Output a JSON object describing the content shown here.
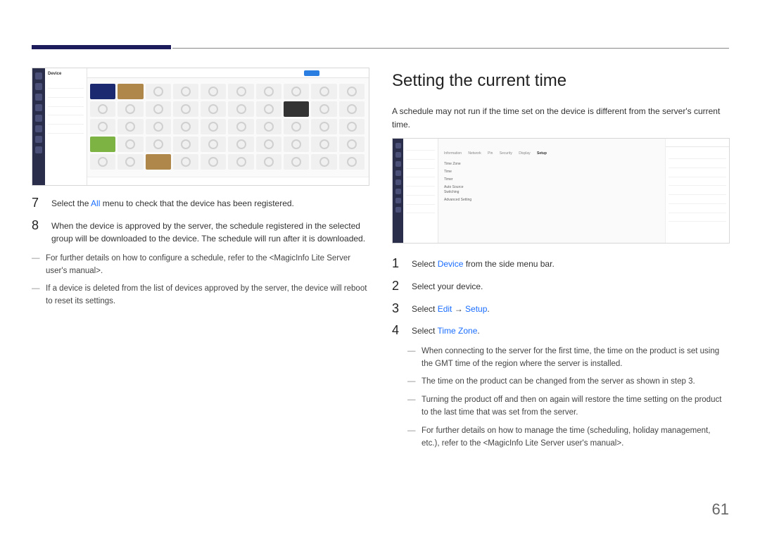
{
  "page_number": "61",
  "left": {
    "screenshot": {
      "sidepanel_title": "Device",
      "topbar_label": "All"
    },
    "steps": [
      {
        "num": "7",
        "pre": "Select the ",
        "link": "All",
        "post": " menu to check that the device has been registered."
      },
      {
        "num": "8",
        "text": "When the device is approved by the server, the schedule registered in the selected group will be downloaded to the device. The schedule will run after it is downloaded."
      }
    ],
    "notes": [
      "For further details on how to configure a schedule, refer to the <MagicInfo Lite Server user's manual>.",
      "If a device is deleted from the list of devices approved by the server, the device will reboot to reset its settings."
    ]
  },
  "right": {
    "title": "Setting the current time",
    "intro": "A schedule may not run if the time set on the device is different from the server's current time.",
    "screenshot": {
      "tabs": [
        "Information",
        "Network",
        "Pin",
        "Security",
        "Display",
        "Setup"
      ],
      "active_tab": "Setup",
      "fields": [
        "Time Zone",
        "Time",
        "Timer",
        "Auto Source Switching",
        "Advanced Setting"
      ]
    },
    "steps": [
      {
        "num": "1",
        "parts": [
          "Select ",
          {
            "link": "Device"
          },
          " from the side menu bar."
        ]
      },
      {
        "num": "2",
        "parts": [
          "Select your device."
        ]
      },
      {
        "num": "3",
        "parts": [
          "Select ",
          {
            "link": "Edit"
          },
          " → ",
          {
            "link": "Setup"
          },
          "."
        ]
      },
      {
        "num": "4",
        "parts": [
          "Select ",
          {
            "link": "Time Zone"
          },
          "."
        ]
      }
    ],
    "notes": [
      "When connecting to the server for the first time, the time on the product is set using the GMT time of the region where the server is installed.",
      "The time on the product can be changed from the server as shown in step 3.",
      "Turning the product off and then on again will restore the time setting on the product to the last time that was set from the server.",
      "For further details on how to manage the time (scheduling, holiday management, etc.), refer to the <MagicInfo Lite Server user's manual>."
    ]
  }
}
